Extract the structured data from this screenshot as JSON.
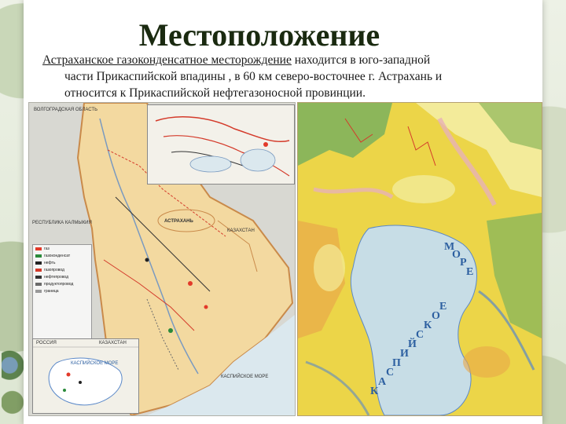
{
  "slide": {
    "title": "Местоположение",
    "description": {
      "underlined": "Астраханское газоконденсатное месторождение",
      "rest_line1": "находится в юго-западной",
      "line2": "части Прикаспийской впадины , в 60 км северо-восточнее г. Астрахань и",
      "line3": "относится к Прикаспийской нефтегазоносной провинции."
    }
  },
  "map_left": {
    "labels": {
      "volgograd": "ВОЛГОГРАДСКАЯ ОБЛАСТЬ",
      "kalmykia": "РЕСПУБЛИКА КАЛМЫКИЯ",
      "kazakhstan": "КАЗАХСТАН",
      "astrakhan": "АСТРАХАНЬ",
      "caspian": "КАСПИЙСКОЕ МОРЕ",
      "russia": "РОССИЯ",
      "kazakhstan_inset": "КАЗАХСТАН",
      "caspian_inset": "КАСПИЙСКОЕ МОРЕ"
    },
    "legend": [
      {
        "label": "газ",
        "color": "#e23a2a"
      },
      {
        "label": "газоконденсат",
        "color": "#2a8a3a"
      },
      {
        "label": "нефть",
        "color": "#222222"
      },
      {
        "label": "газопровод",
        "color": "#d43a2a"
      },
      {
        "label": "нефтепровод",
        "color": "#333333"
      },
      {
        "label": "продуктопровод",
        "color": "#6a6a6a"
      },
      {
        "label": "граница",
        "color": "#999999"
      }
    ],
    "colors": {
      "territory": "#f3d9a0",
      "border": "#c98a4a",
      "neighbors": "#d8d8d2",
      "sea": "#dbe8ee"
    }
  },
  "map_right": {
    "sea_letters": [
      "М",
      "О",
      "Р",
      "Е",
      "К",
      "А",
      "С",
      "П",
      "И",
      "Й",
      "С",
      "К",
      "О",
      "Е"
    ],
    "colors": {
      "sea": "#c7dde6",
      "yellow": "#ecd548",
      "pale": "#f3eb9a",
      "green": "#8cb65a",
      "pink": "#e7b2b8",
      "blue": "#5a88c8",
      "orange": "#e9a84a"
    }
  }
}
